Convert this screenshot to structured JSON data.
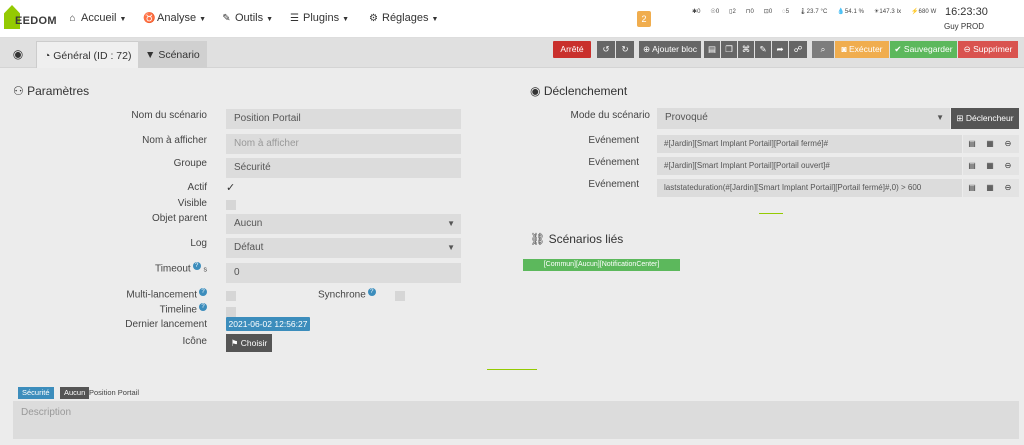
{
  "navbar": {
    "logo_text": "EEDOM",
    "menu": [
      {
        "label": "Accueil",
        "icon": "home-icon"
      },
      {
        "label": "Analyse",
        "icon": "stethoscope-icon"
      },
      {
        "label": "Outils",
        "icon": "wrench-icon"
      },
      {
        "label": "Plugins",
        "icon": "tasks-icon"
      },
      {
        "label": "Réglages",
        "icon": "cogs-icon"
      }
    ],
    "message_count": "2",
    "sensors": [
      "0",
      "0",
      "2",
      "0",
      "0",
      "5",
      "23.7 °C",
      "54.1 %",
      "147.3 lx",
      "680 W"
    ],
    "time": "16:23:30",
    "user": "Guy PROD"
  },
  "tabs": {
    "general": "Général (ID : 72)",
    "scenario": "Scénario"
  },
  "toolbar": {
    "state": "Arrêté",
    "add_block": "Ajouter bloc",
    "execute": "Exécuter",
    "save": "Sauvegarder",
    "delete": "Supprimer"
  },
  "params": {
    "title": "Paramètres",
    "name_label": "Nom du scénario",
    "name_value": "Position Portail",
    "display_label": "Nom à afficher",
    "display_placeholder": "Nom à afficher",
    "group_label": "Groupe",
    "group_value": "Sécurité",
    "active_label": "Actif",
    "visible_label": "Visible",
    "parent_label": "Objet parent",
    "parent_value": "Aucun",
    "log_label": "Log",
    "log_value": "Défaut",
    "timeout_label": "Timeout",
    "timeout_unit": "s",
    "timeout_value": "0",
    "multi_label": "Multi-lancement",
    "sync_label": "Synchrone",
    "timeline_label": "Timeline",
    "last_run_label": "Dernier lancement",
    "last_run_value": "2021-06-02 12:56:27",
    "icon_label": "Icône",
    "choose_label": "Choisir"
  },
  "trigger": {
    "title": "Déclenchement",
    "mode_label": "Mode du scénario",
    "mode_value": "Provoqué",
    "add_trigger": "Déclencheur",
    "events": [
      {
        "label": "Evénement",
        "value": "#[Jardin][Smart Implant Portail][Portail fermé]#"
      },
      {
        "label": "Evénement",
        "value": "#[Jardin][Smart Implant Portail][Portail ouvert]#"
      },
      {
        "label": "Evénement",
        "value": "laststateduration(#[Jardin][Smart Implant Portail][Portail fermé]#,0) > 600"
      }
    ]
  },
  "linked": {
    "title": "Scénarios liés",
    "item": "[Commun][Aucun][NotificationCenter]"
  },
  "footer": {
    "tag_group": "Sécurité",
    "tag_parent": "Aucun",
    "tag_name": "Position Portail",
    "description_placeholder": "Description"
  },
  "colors": {
    "accent": "#94ca02",
    "danger": "#d9534f",
    "success": "#5cb85c",
    "warning": "#f0ad4e",
    "info": "#3c8dbc"
  }
}
